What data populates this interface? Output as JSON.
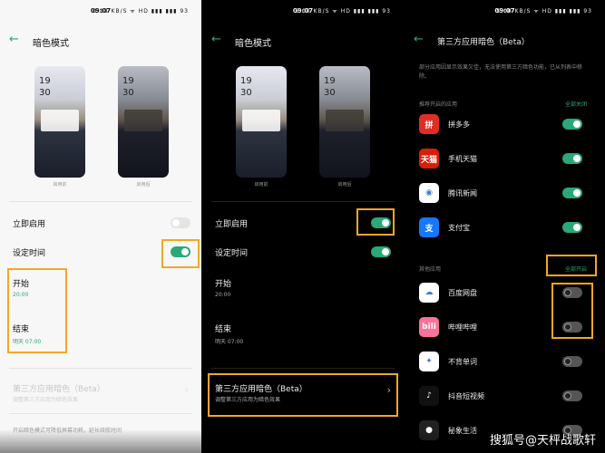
{
  "panel1": {
    "status": {
      "time": "09:07",
      "icons": "0.18 KB/S ᯤ HD ▮▮▮ ▮▮▮ 93"
    },
    "title": "暗色模式",
    "phones": [
      {
        "time1": "19",
        "time2": "30",
        "label": "启用前"
      },
      {
        "time1": "19",
        "time2": "30",
        "label": "启用后"
      }
    ],
    "enable_now": "立即启用",
    "set_time": "设定时间",
    "start_label": "开始",
    "start_value": "20:00",
    "end_label": "结束",
    "end_value": "明天 07:00",
    "third_party_title": "第三方应用暗色（Beta）",
    "third_party_sub": "调整第三方应用为暗色效果",
    "footer": "开启暗色模式可降低屏幕功耗，延长续航时间"
  },
  "panel2": {
    "status": {
      "time": "09:07",
      "icons": "5.00 KB/S ᯤ HD ▮▮▮ ▮▮▮ 93"
    },
    "title": "暗色模式",
    "phones": [
      {
        "time1": "19",
        "time2": "30",
        "label": "启用前"
      },
      {
        "time1": "19",
        "time2": "30",
        "label": "启用后"
      }
    ],
    "enable_now": "立即启用",
    "set_time": "设定时间",
    "start_label": "开始",
    "start_value": "20:00",
    "end_label": "结束",
    "end_value": "明天 07:00",
    "third_party_title": "第三方应用暗色（Beta）",
    "third_party_sub": "调整第三方应用为暗色效果"
  },
  "panel3": {
    "status": {
      "time": "09:07",
      "icons": "5.00 KB/S ᯤ HD ▮▮▮ ▮▮▮ 93"
    },
    "title": "第三方应用暗色（Beta）",
    "description": "部分应用因显示效果欠佳，无法使用第三方暗色功能，已从列表中移除。",
    "recommended_header": "推荐开启的应用",
    "close_all": "全部关闭",
    "other_header": "其他应用",
    "open_all": "全部开启",
    "recommended": [
      {
        "name": "拼多多",
        "icon": "pinduoduo-icon",
        "color": "#e02e24",
        "glyph": "拼",
        "on": true
      },
      {
        "name": "手机天猫",
        "icon": "tmall-icon",
        "color": "#d81e06",
        "glyph": "天猫",
        "on": true
      },
      {
        "name": "腾讯新闻",
        "icon": "tencent-news-icon",
        "color": "#ffffff",
        "glyph": "◉",
        "on": true
      },
      {
        "name": "支付宝",
        "icon": "alipay-icon",
        "color": "#1677ff",
        "glyph": "支",
        "on": true
      }
    ],
    "others": [
      {
        "name": "百度网盘",
        "icon": "baidu-netdisk-icon",
        "color": "#ffffff",
        "glyph": "☁",
        "on": false
      },
      {
        "name": "哔哩哔哩",
        "icon": "bilibili-icon",
        "color": "#fb7299",
        "glyph": "bili",
        "on": false
      },
      {
        "name": "不背单词",
        "icon": "bubei-icon",
        "color": "#ffffff",
        "glyph": "✦",
        "on": false
      },
      {
        "name": "抖音短视频",
        "icon": "douyin-icon",
        "color": "#111111",
        "glyph": "♪",
        "on": false
      },
      {
        "name": "秘象生活",
        "icon": "mixiang-icon",
        "color": "#222222",
        "glyph": "●",
        "on": false
      }
    ]
  },
  "watermark": "搜狐号@天枰战歌轩"
}
